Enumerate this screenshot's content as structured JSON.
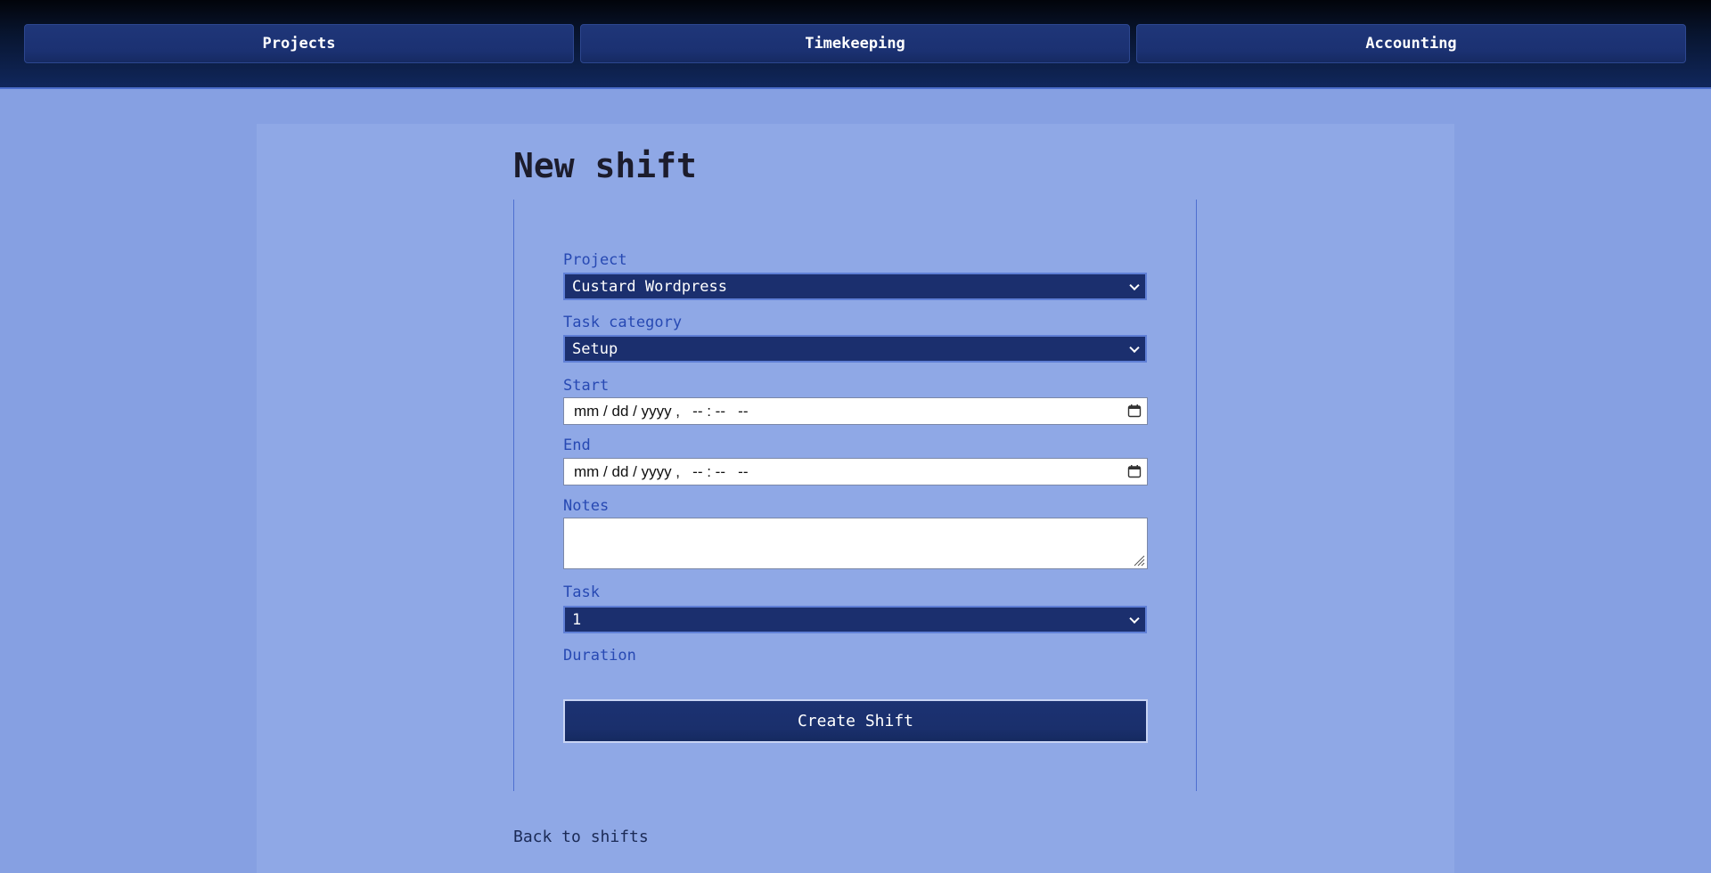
{
  "nav": {
    "projects": "Projects",
    "timekeeping": "Timekeeping",
    "accounting": "Accounting"
  },
  "page": {
    "title": "New shift"
  },
  "form": {
    "project_label": "Project",
    "project_value": "Custard Wordpress",
    "task_category_label": "Task category",
    "task_category_value": "Setup",
    "start_label": "Start",
    "start_value": "mm / dd / yyyy ,   -- : --   --",
    "end_label": "End",
    "end_value": "mm / dd / yyyy ,   -- : --   --",
    "notes_label": "Notes",
    "notes_value": "",
    "task_label": "Task",
    "task_value": "1",
    "duration_label": "Duration",
    "submit_label": "Create Shift"
  },
  "footer": {
    "back_link": "Back to shifts"
  },
  "colors": {
    "background": "#86a0e2",
    "panel": "#8fa8e6",
    "navbar": "#081530",
    "button": "#1b3172",
    "label": "#2749b3"
  },
  "icons": {
    "start_picker": "calendar-icon",
    "end_picker": "calendar-icon",
    "select_arrow": "chevron-down-icon",
    "textarea_resize": "resize-handle-icon"
  }
}
